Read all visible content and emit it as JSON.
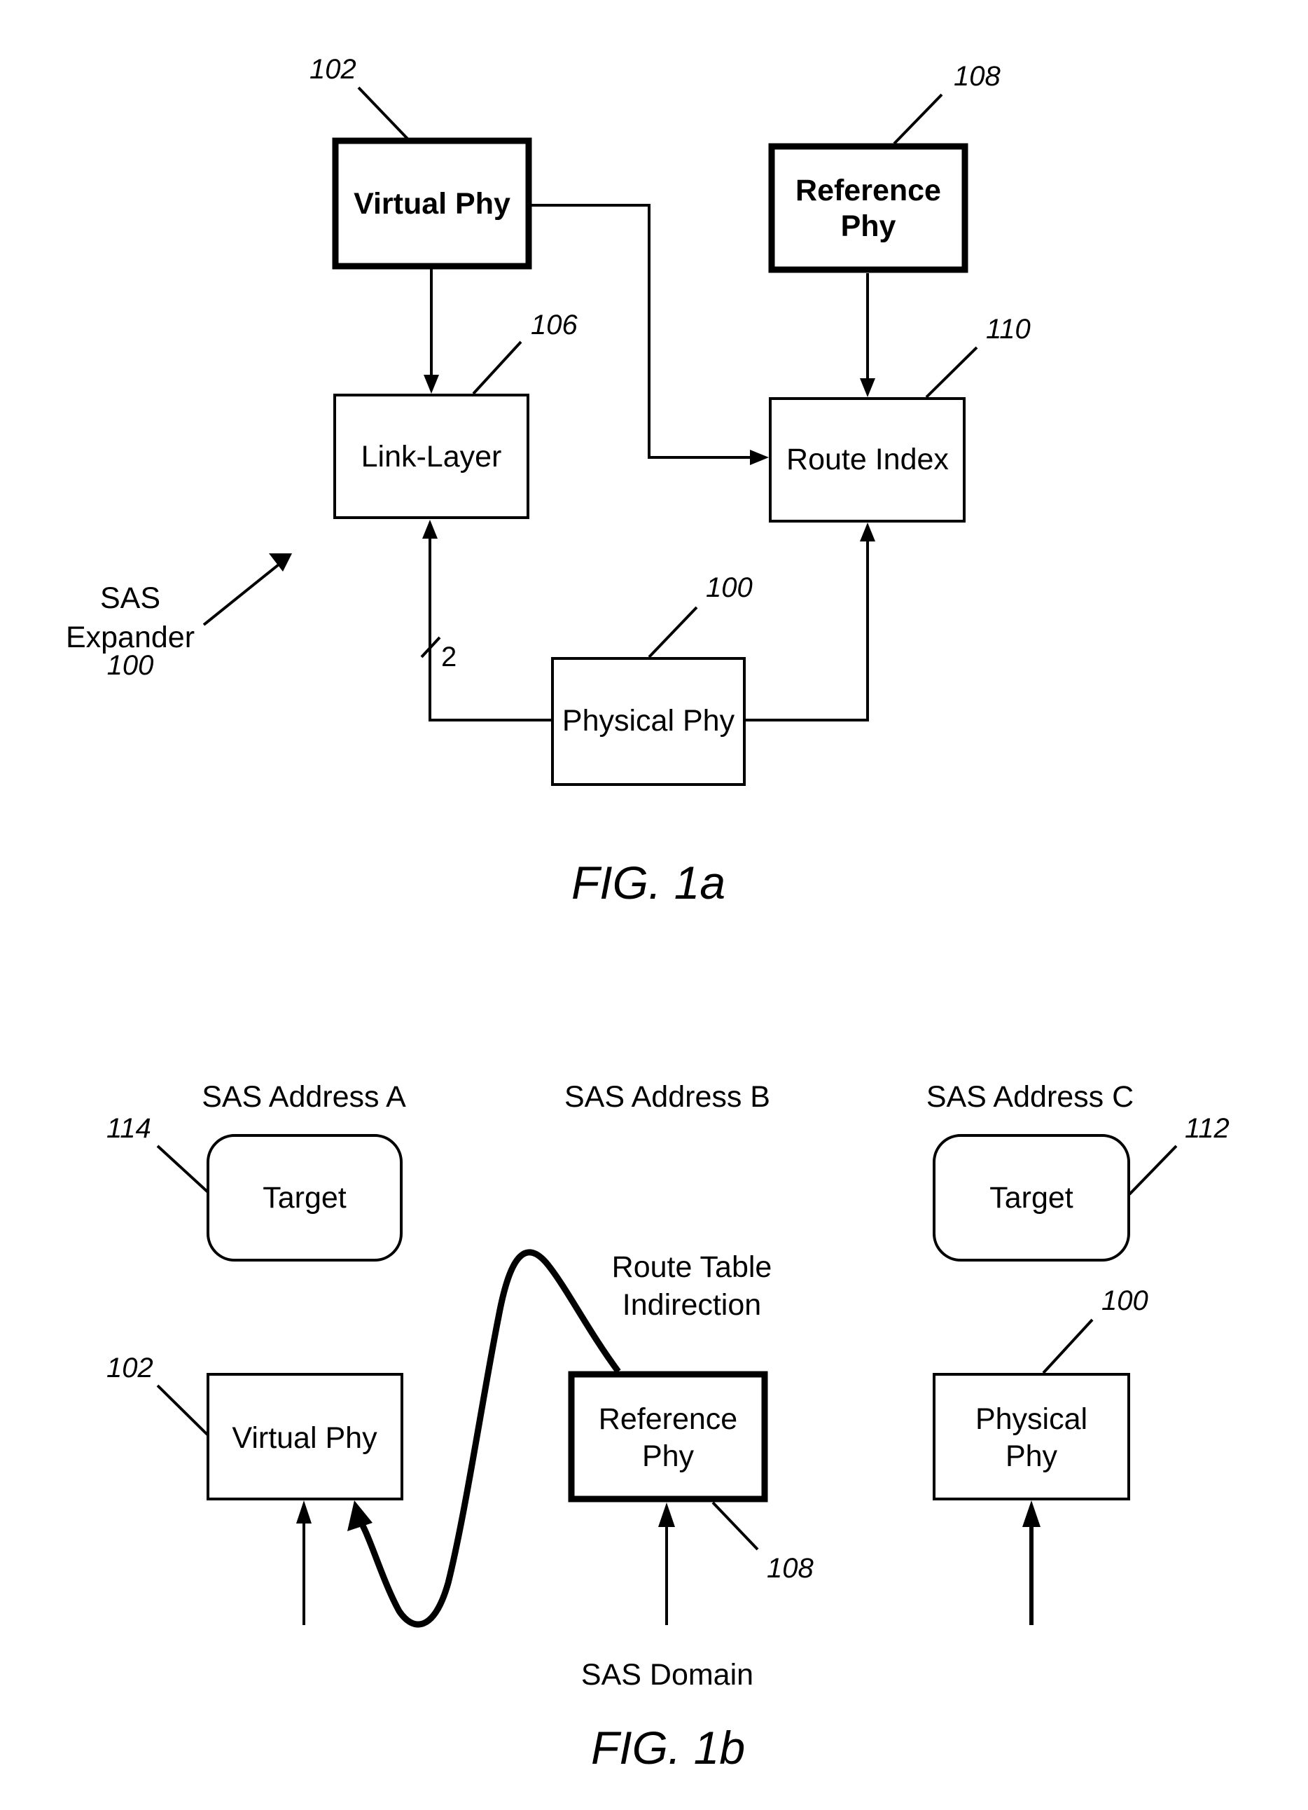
{
  "fig1a": {
    "caption": "FIG. 1a",
    "virtual_phy": {
      "line1": "Virtual Phy",
      "ref": "102"
    },
    "reference_phy": {
      "line1": "Reference",
      "line2": "Phy",
      "ref": "108"
    },
    "link_layer": {
      "line1": "Link-Layer",
      "ref": "106"
    },
    "route_index": {
      "line1": "Route Index",
      "ref": "110"
    },
    "physical_phy": {
      "line1": "Physical Phy",
      "ref": "100"
    },
    "bus_width": "2",
    "sas_expander": {
      "line1": "SAS",
      "line2": "Expander",
      "ref": "100"
    }
  },
  "fig1b": {
    "caption": "FIG. 1b",
    "addresses": [
      "SAS Address A",
      "SAS Address B",
      "SAS Address C"
    ],
    "target_a": {
      "label": "Target",
      "ref": "114"
    },
    "target_c": {
      "label": "Target",
      "ref": "112"
    },
    "virtual_phy": {
      "line1": "Virtual Phy",
      "ref": "102"
    },
    "reference_phy": {
      "line1": "Reference",
      "line2": "Phy",
      "ref": "108"
    },
    "physical_phy": {
      "line1": "Physical",
      "line2": "Phy",
      "ref": "100"
    },
    "route_table": {
      "line1": "Route Table",
      "line2": "Indirection"
    },
    "domain_label": "SAS Domain"
  }
}
